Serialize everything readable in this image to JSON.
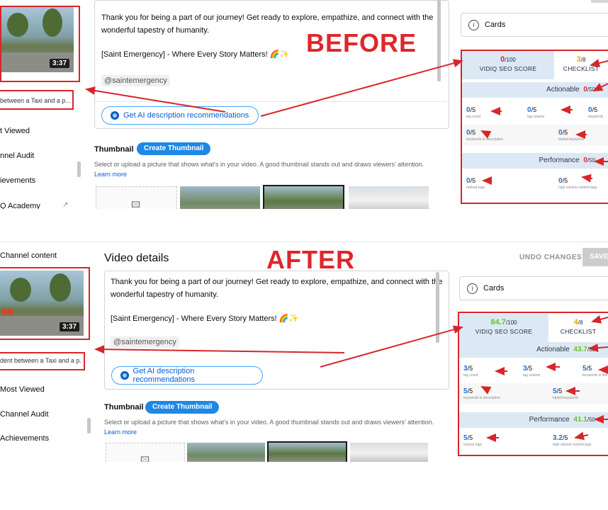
{
  "labels": {
    "before": "BEFORE",
    "after": "AFTER"
  },
  "header": {
    "title": "Video details",
    "undo": "UNDO CHANGES",
    "save": "SAVE"
  },
  "nav": {
    "channel_content": "Channel content",
    "duration": "3:37",
    "before_video_title": "between a Taxi and a p...",
    "after_video_title": "dent between a Taxi and a p...",
    "before_items": [
      "t Viewed",
      "nnel Audit",
      "ievements",
      "Q Academy"
    ],
    "after_items": [
      "Most Viewed",
      "Channel Audit",
      "Achievements"
    ]
  },
  "description": {
    "line1": "Thank you for being a part of our journey! Get ready to explore, empathize, and connect with the",
    "line2": "wonderful tapestry of humanity.",
    "line3": "[Saint Emergency] - Where Every Story Matters! 🌈✨",
    "mention": "@saintemergency",
    "ai_button": "Get AI description recommendations"
  },
  "thumbnail": {
    "label": "Thumbnail",
    "create_button": "Create Thumbnail",
    "help": "Select or upload a picture that shows what's in your video. A good thumbnail stands out and draws viewers' attention.",
    "learn_more": "Learn more"
  },
  "cards": {
    "label": "Cards",
    "info_icon": "i"
  },
  "vidiq_before": {
    "seo_score": "0",
    "seo_max": "/100",
    "seo_label": "VIDIQ SEO SCORE",
    "checklist_score": "3",
    "checklist_max": "/8",
    "checklist_label": "CHECKLIST",
    "actionable_label": "Actionable",
    "actionable_score": "0",
    "actionable_max": "/50",
    "metrics": [
      {
        "val": "0",
        "max": "/5",
        "cap": "tag count"
      },
      {
        "val": "0",
        "max": "/5",
        "cap": "tag volume"
      },
      {
        "val": "0",
        "max": "/5",
        "cap": "keywords"
      },
      {
        "val": "0",
        "max": "/5",
        "cap": "keywords in description"
      },
      {
        "val": "0",
        "max": "/5",
        "cap": "tripled keywords"
      }
    ],
    "performance_label": "Performance",
    "performance_score": "0",
    "performance_max": "/50",
    "perf_metrics": [
      {
        "val": "0",
        "max": "/5",
        "cap": "ranked tags"
      },
      {
        "val": "0",
        "max": "/5",
        "cap": "high volume ranked tags"
      }
    ]
  },
  "vidiq_after": {
    "seo_score": "84.7",
    "seo_max": "/100",
    "seo_label": "VIDIQ SEO SCORE",
    "checklist_score": "4",
    "checklist_max": "/8",
    "checklist_label": "CHECKLIST",
    "actionable_label": "Actionable",
    "actionable_score": "43.7",
    "actionable_max": "/50",
    "metrics": [
      {
        "val": "3",
        "max": "/5",
        "cap": "tag count"
      },
      {
        "val": "3",
        "max": "/5",
        "cap": "tag volume"
      },
      {
        "val": "5",
        "max": "/5",
        "cap": "keywords in title"
      },
      {
        "val": "5",
        "max": "/5",
        "cap": "keywords in description"
      },
      {
        "val": "5",
        "max": "/5",
        "cap": "tripled keywords"
      }
    ],
    "performance_label": "Performance",
    "performance_score": "41.1",
    "performance_max": "/50",
    "perf_metrics": [
      {
        "val": "5",
        "max": "/5",
        "cap": "ranked tags"
      },
      {
        "val": "3.2",
        "max": "/5",
        "cap": "high volume ranked tags"
      }
    ]
  },
  "colors": {
    "annotation_red": "#d7262b",
    "score_orange": "#f5a400",
    "score_green": "#6bbf2a",
    "link_blue": "#065fd4"
  }
}
